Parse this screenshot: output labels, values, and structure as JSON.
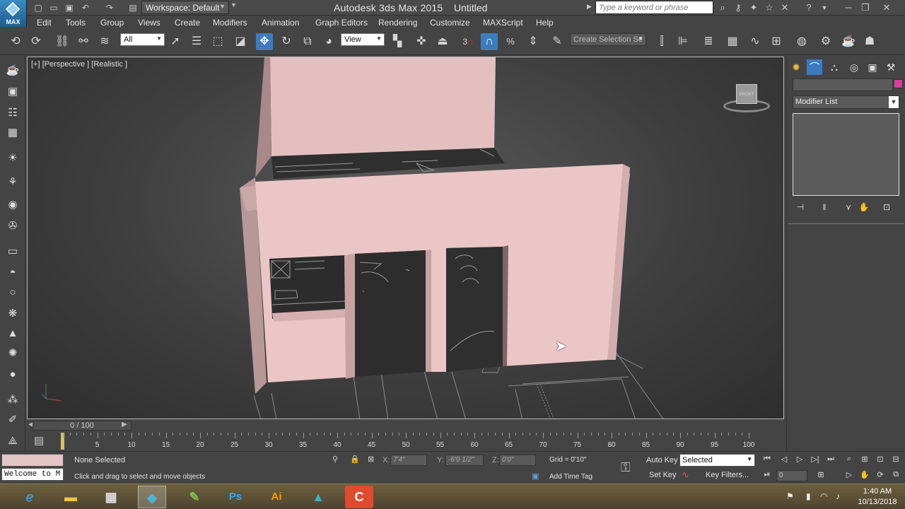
{
  "titlebar": {
    "logo_label": "MAX",
    "workspace": "Workspace: Default",
    "app_title": "Autodesk 3ds Max  2015",
    "doc_name": "Untitled",
    "search_placeholder": "Type a keyword or phrase"
  },
  "menu": [
    "Edit",
    "Tools",
    "Group",
    "Views",
    "Create",
    "Modifiers",
    "Animation",
    "Graph Editors",
    "Rendering",
    "Customize",
    "MAXScript",
    "Help"
  ],
  "toolbar": {
    "filter_dropdown": "All",
    "coord_dropdown": "View",
    "selection_set": "Create Selection Se",
    "snap_label": "3"
  },
  "viewport": {
    "label": "[+] [Perspective ] [Realistic ]",
    "viewcube_face": "FRONT",
    "wall_color": "#e8c2c2"
  },
  "command_panel": {
    "modifier_list": "Modifier List",
    "color_swatch": "#d63ea0"
  },
  "timeline": {
    "frame_display": "0 / 100",
    "ticks": [
      "5",
      "10",
      "15",
      "20",
      "25",
      "30",
      "35",
      "40",
      "45",
      "50",
      "55",
      "60",
      "65",
      "70",
      "75",
      "80",
      "85",
      "90",
      "95",
      "100"
    ]
  },
  "status": {
    "selection": "None Selected",
    "prompt": "Click and drag to select and move objects",
    "maxscript_text": "Welcome to M",
    "x_label": "X:",
    "x_value": "7'4\"",
    "y_label": "Y:",
    "y_value": "-6'9 1/2\"",
    "z_label": "Z:",
    "z_value": "0'0\"",
    "grid": "Grid = 0'10\"",
    "add_time_tag": "Add Time Tag",
    "auto_key": "Auto Key",
    "set_key": "Set Key",
    "key_mode": "Selected",
    "key_filters": "Key Filters...",
    "frame_value": "0"
  },
  "taskbar": {
    "time": "1:40 AM",
    "date": "10/13/2018",
    "apps": [
      "Internet Explorer",
      "File Explorer",
      "Grid App",
      "3ds Max",
      "Green App",
      "Photoshop",
      "Illustrator",
      "Teal App",
      "Camtasia"
    ]
  }
}
